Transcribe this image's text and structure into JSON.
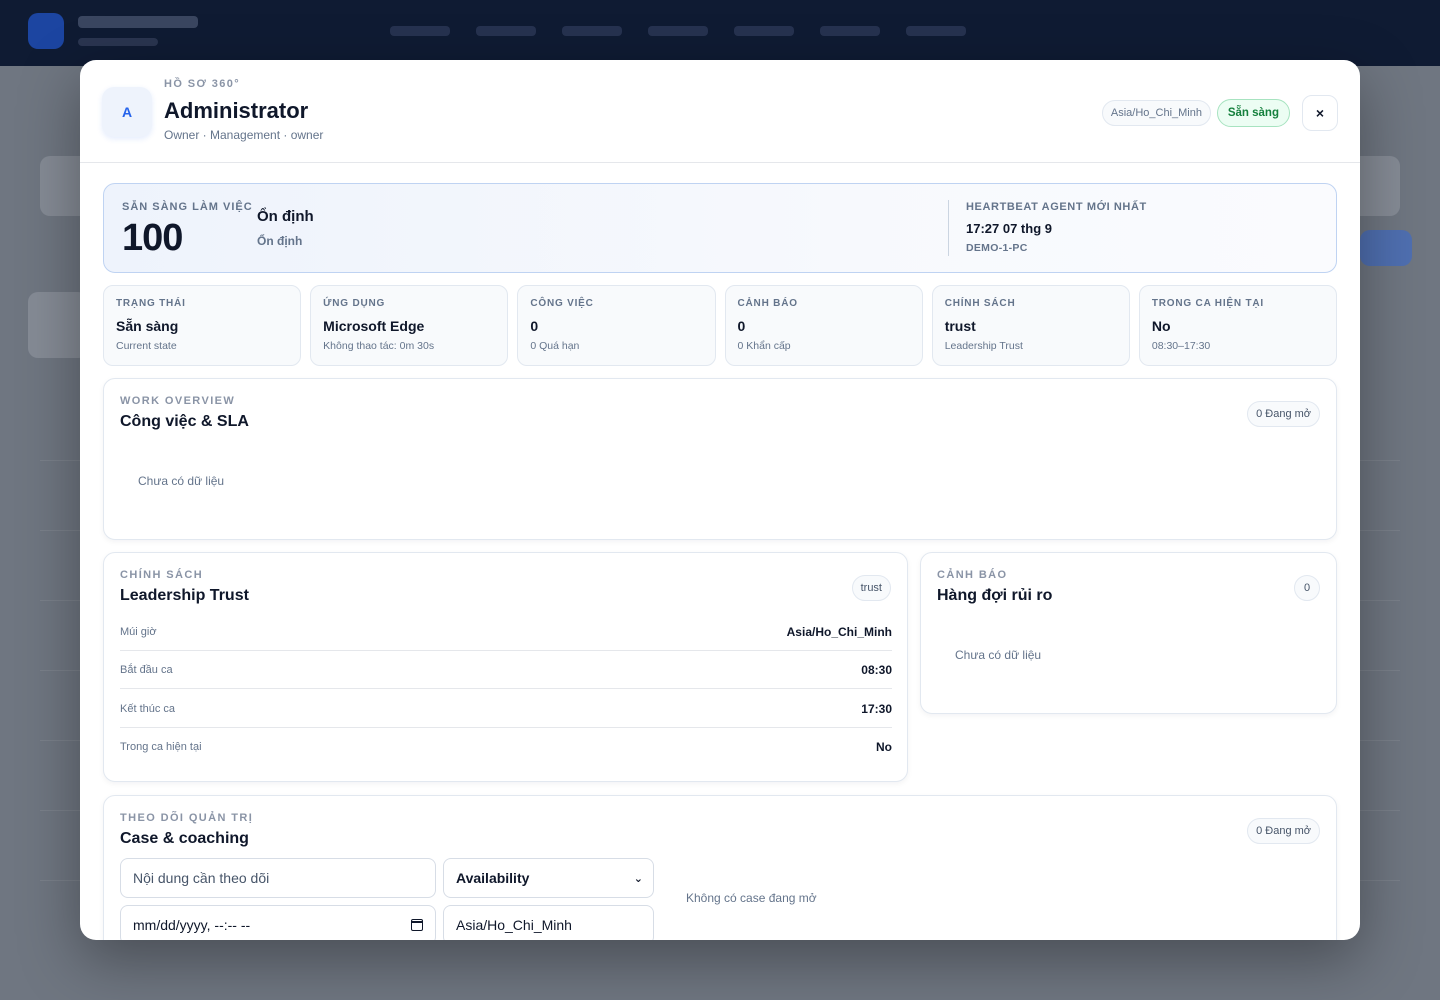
{
  "modal": {
    "eyebrow": "HỒ SƠ 360°",
    "avatar_initial": "A",
    "name": "Administrator",
    "subtitle": "Owner · Management · owner",
    "timezone_pill": "Asia/Ho_Chi_Minh",
    "status_pill": "Sẵn sàng",
    "close_label": "×"
  },
  "readiness": {
    "label": "SẴN SÀNG LÀM VIỆC",
    "score": "100",
    "state": "Ổn định",
    "state_sub": "Ổn định",
    "heartbeat_label": "HEARTBEAT AGENT MỚI NHẤT",
    "heartbeat_time": "17:27 07 thg 9",
    "heartbeat_host": "DEMO-1-PC"
  },
  "stats": [
    {
      "label": "TRẠNG THÁI",
      "value": "Sẵn sàng",
      "sub": "Current state"
    },
    {
      "label": "ỨNG DỤNG",
      "value": "Microsoft Edge",
      "sub": "Không thao tác: 0m 30s"
    },
    {
      "label": "CÔNG VIỆC",
      "value": "0",
      "sub": "0 Quá hạn"
    },
    {
      "label": "CẢNH BÁO",
      "value": "0",
      "sub": "0 Khẩn cấp"
    },
    {
      "label": "CHÍNH SÁCH",
      "value": "trust",
      "sub": "Leadership Trust"
    },
    {
      "label": "TRONG CA HIỆN TẠI",
      "value": "No",
      "sub": "08:30–17:30"
    }
  ],
  "work": {
    "eyebrow": "WORK OVERVIEW",
    "title": "Công việc & SLA",
    "pill": "0 Đang mở",
    "empty": "Chưa có dữ liệu"
  },
  "policy": {
    "eyebrow": "CHÍNH SÁCH",
    "title": "Leadership Trust",
    "pill": "trust",
    "rows": [
      {
        "key": "Múi giờ",
        "value": "Asia/Ho_Chi_Minh"
      },
      {
        "key": "Bắt đầu ca",
        "value": "08:30"
      },
      {
        "key": "Kết thúc ca",
        "value": "17:30"
      },
      {
        "key": "Trong ca hiện tại",
        "value": "No"
      }
    ]
  },
  "alerts": {
    "eyebrow": "CẢNH BÁO",
    "title": "Hàng đợi rủi ro",
    "pill": "0",
    "empty": "Chưa có dữ liệu"
  },
  "cases": {
    "eyebrow": "THEO DÕI QUẢN TRỊ",
    "title": "Case & coaching",
    "pill": "0 Đang mở",
    "content_placeholder": "Nội dung cần theo dõi",
    "type_select": "Availability",
    "datetime_placeholder": "mm/dd/yyyy, --:-- --",
    "timezone_value": "Asia/Ho_Chi_Minh",
    "empty": "Không có case đang mở"
  }
}
